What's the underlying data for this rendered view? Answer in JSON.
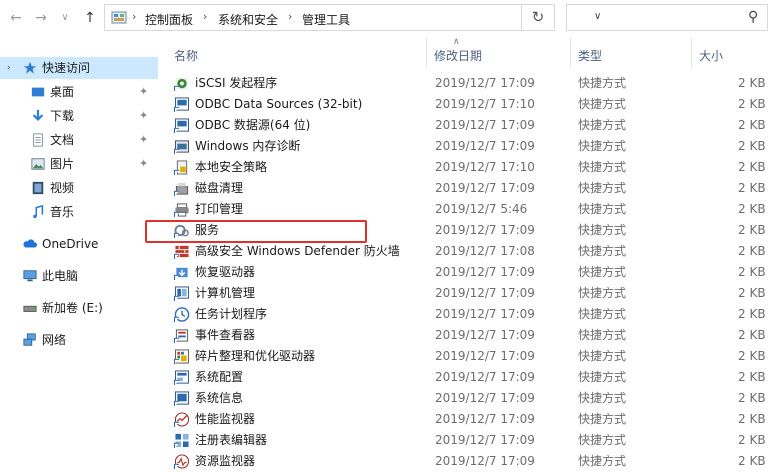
{
  "nav": {
    "back": "←",
    "forward": "→",
    "recent": "∨",
    "up": "↑"
  },
  "breadcrumb": [
    "控制面板",
    "系统和安全",
    "管理工具"
  ],
  "sidebar": {
    "items": [
      {
        "label": "快速访问",
        "icon": "star-icon",
        "pinned": false,
        "chevron": true
      },
      {
        "label": "桌面",
        "icon": "desktop-icon",
        "pinned": true
      },
      {
        "label": "下载",
        "icon": "download-icon",
        "pinned": true
      },
      {
        "label": "文档",
        "icon": "document-icon",
        "pinned": true
      },
      {
        "label": "图片",
        "icon": "picture-icon",
        "pinned": true
      },
      {
        "label": "视频",
        "icon": "video-icon",
        "pinned": false
      },
      {
        "label": "音乐",
        "icon": "music-icon",
        "pinned": false
      },
      {
        "label": "OneDrive",
        "icon": "onedrive-icon",
        "pinned": false
      },
      {
        "label": "此电脑",
        "icon": "computer-icon",
        "pinned": false
      },
      {
        "label": "新加卷 (E:)",
        "icon": "drive-icon",
        "pinned": false
      },
      {
        "label": "网络",
        "icon": "network-icon",
        "pinned": false
      }
    ]
  },
  "columns": {
    "name": "名称",
    "date": "修改日期",
    "type": "类型",
    "size": "大小"
  },
  "files": [
    {
      "name": "iSCSI 发起程序",
      "date": "2019/12/7 17:09",
      "type": "快捷方式",
      "size": "2 KB"
    },
    {
      "name": "ODBC Data Sources (32-bit)",
      "date": "2019/12/7 17:10",
      "type": "快捷方式",
      "size": "2 KB"
    },
    {
      "name": "ODBC 数据源(64 位)",
      "date": "2019/12/7 17:09",
      "type": "快捷方式",
      "size": "2 KB"
    },
    {
      "name": "Windows 内存诊断",
      "date": "2019/12/7 17:09",
      "type": "快捷方式",
      "size": "2 KB"
    },
    {
      "name": "本地安全策略",
      "date": "2019/12/7 17:10",
      "type": "快捷方式",
      "size": "2 KB"
    },
    {
      "name": "磁盘清理",
      "date": "2019/12/7 17:09",
      "type": "快捷方式",
      "size": "2 KB"
    },
    {
      "name": "打印管理",
      "date": "2019/12/7 5:46",
      "type": "快捷方式",
      "size": "2 KB"
    },
    {
      "name": "服务",
      "date": "2019/12/7 17:09",
      "type": "快捷方式",
      "size": "2 KB"
    },
    {
      "name": "高级安全 Windows Defender 防火墙",
      "date": "2019/12/7 17:08",
      "type": "快捷方式",
      "size": "2 KB"
    },
    {
      "name": "恢复驱动器",
      "date": "2019/12/7 17:09",
      "type": "快捷方式",
      "size": "2 KB"
    },
    {
      "name": "计算机管理",
      "date": "2019/12/7 17:09",
      "type": "快捷方式",
      "size": "2 KB"
    },
    {
      "name": "任务计划程序",
      "date": "2019/12/7 17:09",
      "type": "快捷方式",
      "size": "2 KB"
    },
    {
      "name": "事件查看器",
      "date": "2019/12/7 17:09",
      "type": "快捷方式",
      "size": "2 KB"
    },
    {
      "name": "碎片整理和优化驱动器",
      "date": "2019/12/7 17:09",
      "type": "快捷方式",
      "size": "2 KB"
    },
    {
      "name": "系统配置",
      "date": "2019/12/7 17:09",
      "type": "快捷方式",
      "size": "2 KB"
    },
    {
      "name": "系统信息",
      "date": "2019/12/7 17:09",
      "type": "快捷方式",
      "size": "2 KB"
    },
    {
      "name": "性能监视器",
      "date": "2019/12/7 17:09",
      "type": "快捷方式",
      "size": "2 KB"
    },
    {
      "name": "注册表编辑器",
      "date": "2019/12/7 17:09",
      "type": "快捷方式",
      "size": "2 KB"
    },
    {
      "name": "资源监视器",
      "date": "2019/12/7 17:09",
      "type": "快捷方式",
      "size": "2 KB"
    }
  ],
  "colors": {
    "selection": "#cce8ff",
    "highlight_box": "#e03131",
    "header_text": "#4d6082",
    "meta_text": "#6d6d6d"
  }
}
